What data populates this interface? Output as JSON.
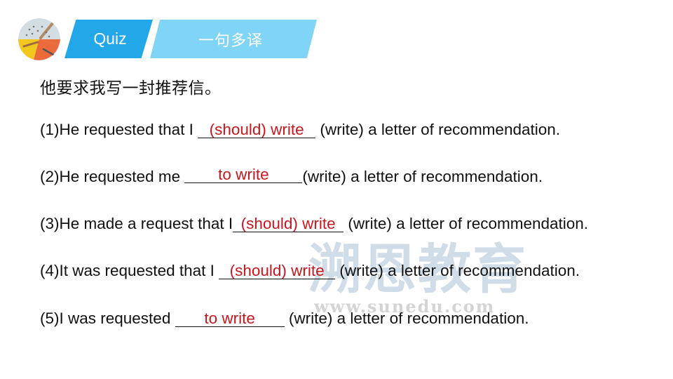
{
  "header": {
    "logo_icon": "pencil-chart-pie-icon",
    "tab_quiz": "Quiz",
    "tab_topic": "一句多译",
    "colors": {
      "quiz_tab": "#22a7e8",
      "topic_tab": "#80d4f6",
      "answer": "#c8161d"
    }
  },
  "prompt": "他要求我写一封推荐信。",
  "sentences": [
    {
      "prefix": "(1)He requested that I ",
      "answer": "(should) write",
      "suffix": " (write) a letter of recommendation."
    },
    {
      "prefix": "(2)He requested me ",
      "answer": "to write",
      "suffix": "(write) a letter of recommendation."
    },
    {
      "prefix": "(3)He made a request that I",
      "answer": "(should) write",
      "suffix": " (write) a letter of recommendation."
    },
    {
      "prefix": "(4)It was requested that I ",
      "answer": "(should) write",
      "suffix": " (write) a letter of recommendation."
    },
    {
      "prefix": "(5)I was requested ",
      "answer": "to write",
      "suffix": " (write) a letter of recommendation."
    }
  ],
  "watermark": {
    "brand": "溯恩教育",
    "url": "www.sunedu.com"
  }
}
